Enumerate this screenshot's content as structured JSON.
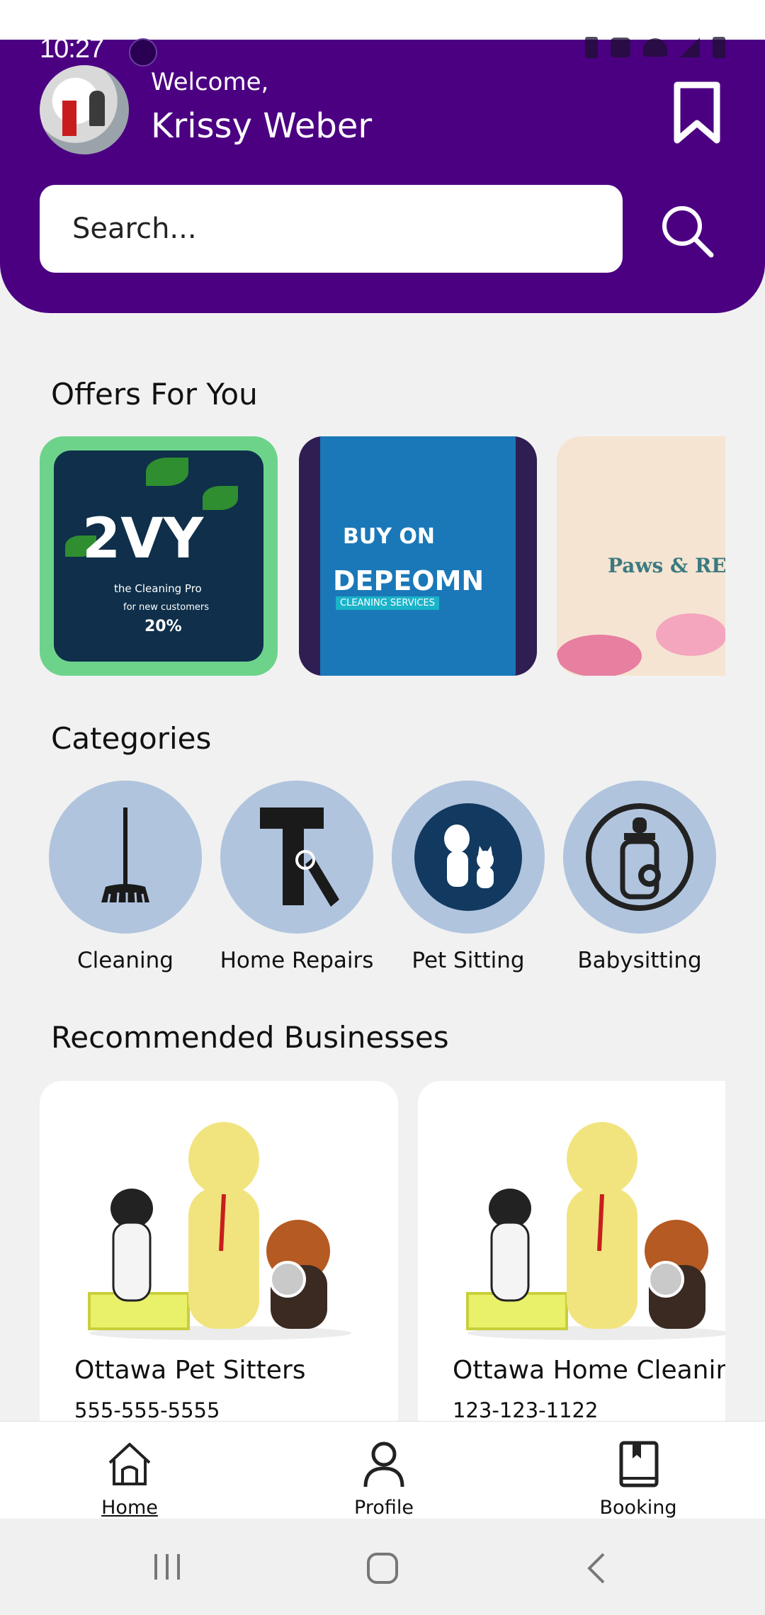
{
  "status_bar": {
    "time": "10:27"
  },
  "header": {
    "welcome": "Welcome,",
    "user_name": "Krissy Weber",
    "colors": {
      "header_bg": "#4b0082",
      "category_circle": "#b0c4de"
    }
  },
  "search": {
    "placeholder": "Search..."
  },
  "offers": {
    "title": "Offers For You",
    "items": [
      {
        "big": "2VY",
        "line1": "the Cleaning Pro",
        "line2": "for new customers",
        "pct": "20%"
      },
      {
        "line1": "BUY ON",
        "line2": "DEPEOMN",
        "line3": "CLEANING SERVICES"
      },
      {
        "line1": "Paws & REelax"
      }
    ]
  },
  "categories": {
    "title": "Categories",
    "items": [
      {
        "label": "Cleaning",
        "icon": "broom-icon"
      },
      {
        "label": "Home Repairs",
        "icon": "hammer-icon"
      },
      {
        "label": "Pet Sitting",
        "icon": "pets-icon"
      },
      {
        "label": "Babysitting",
        "icon": "baby-bottle-icon"
      }
    ]
  },
  "businesses": {
    "title": "Recommended Businesses",
    "items": [
      {
        "name": "Ottawa Pet Sitters",
        "phone": "555-555-5555"
      },
      {
        "name": "Ottawa Home Cleaning",
        "phone": "123-123-1122"
      }
    ]
  },
  "bottom_nav": {
    "items": [
      {
        "label": "Home",
        "icon": "home-icon",
        "active": true
      },
      {
        "label": "Profile",
        "icon": "person-icon"
      },
      {
        "label": "Booking",
        "icon": "book-icon"
      }
    ]
  }
}
